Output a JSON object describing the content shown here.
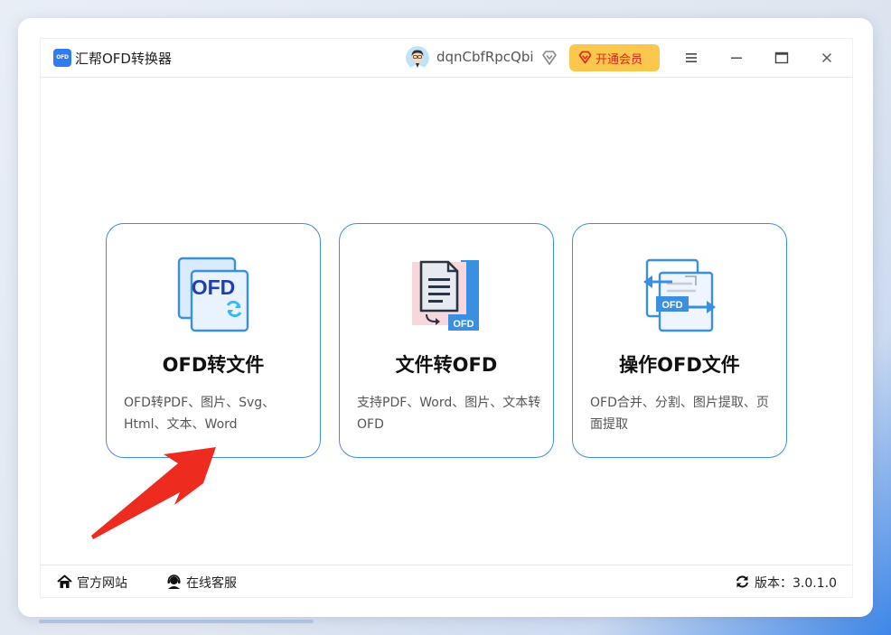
{
  "titlebar": {
    "logo_text": "OFD",
    "app_title": "汇帮OFD转换器",
    "username": "dqnCbfRpcQbi",
    "vip_label": "开通会员"
  },
  "cards": [
    {
      "icon": "ofd-convert-icon",
      "icon_text": "OFD",
      "title": "OFD转文件",
      "desc": "OFD转PDF、图片、Svg、Html、文本、Word"
    },
    {
      "icon": "file-to-ofd-icon",
      "icon_text": "OFD",
      "title": "文件转OFD",
      "desc": "支持PDF、Word、图片、文本转OFD"
    },
    {
      "icon": "ofd-operate-icon",
      "icon_text": "OFD",
      "title": "操作OFD文件",
      "desc": "OFD合并、分割、图片提取、页面提取"
    }
  ],
  "footer": {
    "website": "官方网站",
    "service": "在线客服",
    "version": "版本：3.0.1.0"
  },
  "colors": {
    "accent": "#3a8fe0",
    "vip_bg": "#fcc74d",
    "vip_text": "#e0271f",
    "arrow": "#ee2b1f"
  }
}
